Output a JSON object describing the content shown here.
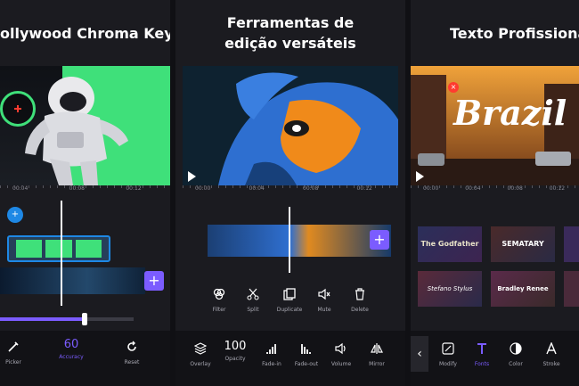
{
  "panels": [
    {
      "caption": "ollywood Chroma Key",
      "ruler": [
        "00:04",
        "00:08",
        "00:12"
      ],
      "tools": [
        {
          "icon": "picker-icon",
          "label": "Picker"
        },
        {
          "icon": "accuracy-value",
          "value": "60",
          "label": "Accuracy"
        },
        {
          "icon": "reset-icon",
          "label": "Reset"
        }
      ]
    },
    {
      "caption_line1": "Ferramentas de",
      "caption_line2": "edição versáteis",
      "ruler": [
        "00:00",
        "00:04",
        "00:08",
        "00:12"
      ],
      "edit_tools": [
        {
          "icon": "filter-icon",
          "label": "Filter"
        },
        {
          "icon": "split-icon",
          "label": "Split"
        },
        {
          "icon": "duplicate-icon",
          "label": "Duplicate"
        },
        {
          "icon": "mute-icon",
          "label": "Mute"
        },
        {
          "icon": "delete-icon",
          "label": "Delete"
        }
      ],
      "bottom_tools": [
        {
          "icon": "overlay-icon",
          "label": "Overlay"
        },
        {
          "icon": "opacity-value",
          "value": "100",
          "label": "Opacity"
        },
        {
          "icon": "fadein-icon",
          "label": "Fade-in"
        },
        {
          "icon": "fadeout-icon",
          "label": "Fade-out"
        },
        {
          "icon": "volume-icon",
          "label": "Volume"
        },
        {
          "icon": "mirror-icon",
          "label": "Mirror"
        }
      ]
    },
    {
      "caption": "Texto Profissiona",
      "preview_text": "Brazil",
      "ruler": [
        "00:00",
        "00:04",
        "00:08",
        "00:12"
      ],
      "styles": [
        "The Godfather",
        "SEMATARY",
        "Stefano Stylus",
        "Bradley Renee"
      ],
      "tools": [
        {
          "icon": "modify-icon",
          "label": "Modify"
        },
        {
          "icon": "fonts-icon",
          "label": "Fonts"
        },
        {
          "icon": "color-icon",
          "label": "Color"
        },
        {
          "icon": "stroke-icon",
          "label": "Stroke"
        }
      ]
    }
  ],
  "colors": {
    "accent": "#7b5cff",
    "chroma_green": "#3fe07a",
    "panel": "#1b1b20",
    "toolbar": "#121216"
  }
}
